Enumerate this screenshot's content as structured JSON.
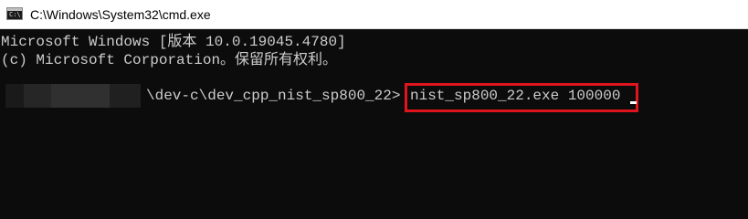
{
  "window": {
    "title": "C:\\Windows\\System32\\cmd.exe",
    "icon": "cmd-terminal-icon",
    "icon_prompt": "C:\\"
  },
  "console": {
    "line1": "Microsoft Windows [版本 10.0.19045.4780]",
    "line2": "(c) Microsoft Corporation。保留所有权利。",
    "prompt_path": "\\dev-c\\dev_cpp_nist_sp800_22>",
    "command": "nist_sp800_22.exe 100000",
    "redaction_color_dark": "#1a1a1a",
    "redaction_color_light": "#303030",
    "highlight_color": "#e0141c",
    "text_color": "#cccccc",
    "background_color": "#0c0c0c"
  }
}
